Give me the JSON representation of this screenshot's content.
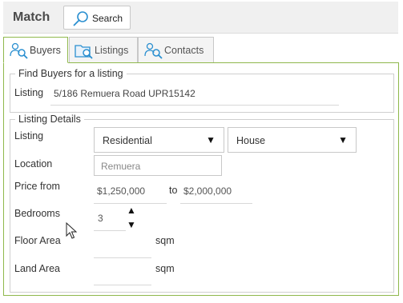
{
  "header": {
    "title": "Match",
    "search_label": "Search"
  },
  "tabs": [
    {
      "label": "Buyers",
      "icon": "people-search-icon",
      "active": true
    },
    {
      "label": "Listings",
      "icon": "folder-search-icon",
      "active": false
    },
    {
      "label": "Contacts",
      "icon": "people-search-icon",
      "active": false
    }
  ],
  "find": {
    "legend": "Find Buyers for a listing",
    "listing_label": "Listing",
    "listing_value": "5/186 Remuera Road UPR15142"
  },
  "details": {
    "legend": "Listing Details",
    "listing_label": "Listing",
    "type_value": "Residential",
    "subtype_value": "House",
    "location_label": "Location",
    "location_placeholder": "Remuera",
    "price_label": "Price from",
    "price_from": "$1,250,000",
    "to_label": "to",
    "price_to": "$2,000,000",
    "bedrooms_label": "Bedrooms",
    "bedrooms_value": "3",
    "floor_label": "Floor Area",
    "floor_unit": "sqm",
    "land_label": "Land Area",
    "land_unit": "sqm",
    "up_arrow": "▲",
    "down_arrow": "▼",
    "dropdown_arrow": "▼"
  }
}
